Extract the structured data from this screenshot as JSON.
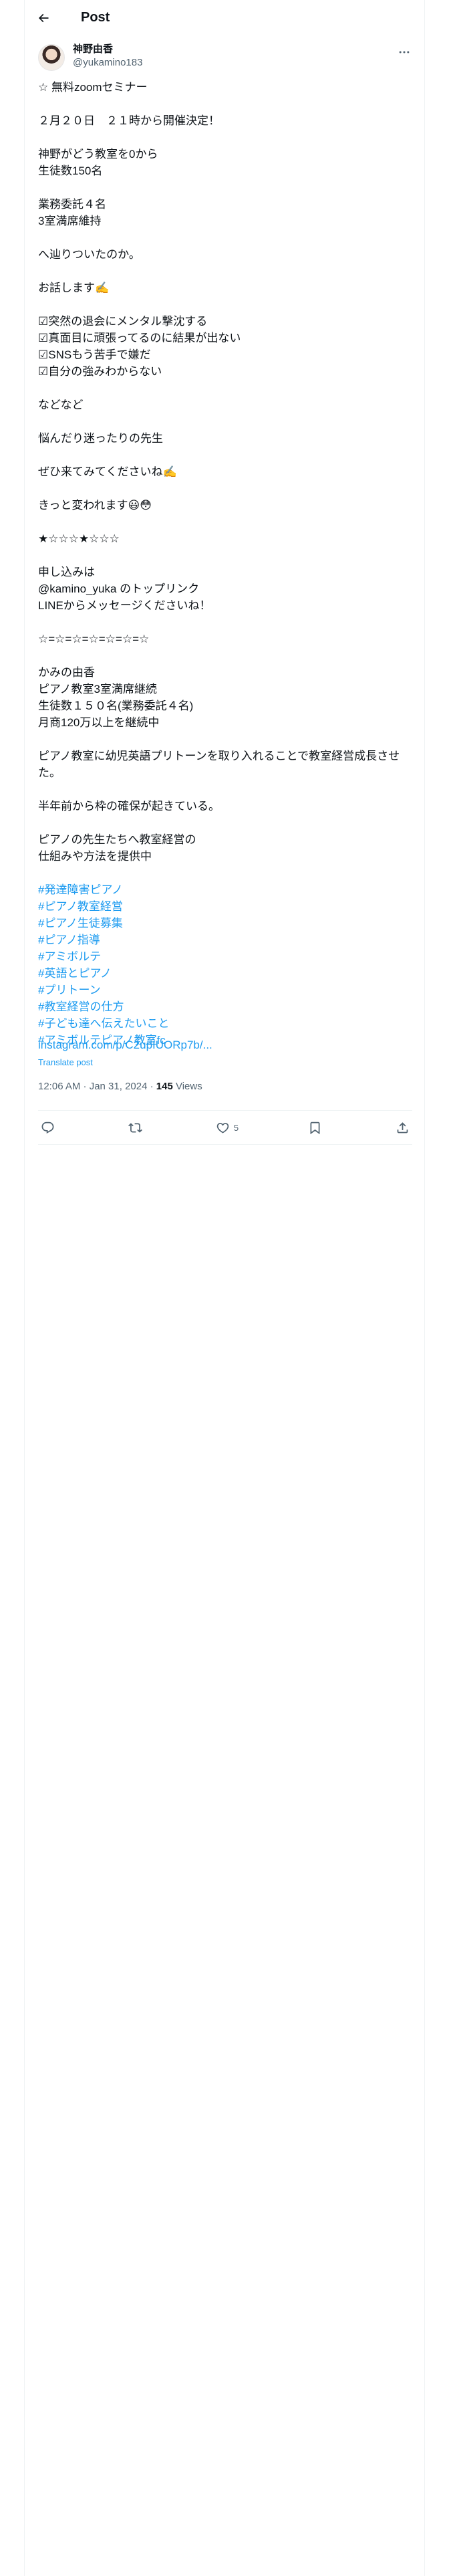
{
  "header": {
    "title": "Post"
  },
  "author": {
    "display_name": "神野由香",
    "handle": "@yukamino183"
  },
  "body_lines": [
    "☆ 無料zoomセミナー",
    "",
    "２月２０日　２１時から開催決定！",
    "",
    "神野がどう教室を0から",
    "生徒数150名",
    "",
    "業務委託４名",
    "3室満席維持",
    "",
    "へ辿りついたのか。",
    "",
    "お話します✍️",
    "",
    "☑︎突然の退会にメンタル撃沈する",
    "☑︎真面目に頑張ってるのに結果が出ない",
    "☑︎SNSもう苦手で嫌だ",
    "☑︎自分の強みわからない",
    "",
    "などなど",
    "",
    "悩んだり迷ったりの先生",
    "",
    "ぜひ来てみてくださいね✍️",
    "",
    "きっと変われます😃😳",
    "",
    "★☆☆☆★☆☆☆",
    "",
    "申し込みは",
    "@kamino_yuka のトップリンク",
    "LINEからメッセージくださいね！",
    "",
    "☆=☆=☆=☆=☆=☆=☆",
    "",
    "かみの由香",
    "ピアノ教室3室満席継続",
    "生徒数１５０名(業務委託４名)",
    "月商120万以上を継続中",
    "",
    "ピアノ教室に幼児英語プリトーンを取り入れることで教室経営成長させた。",
    "",
    "半年前から枠の確保が起きている。",
    "",
    "ピアノの先生たちへ教室経営の",
    "仕組みや方法を提供中",
    ""
  ],
  "hashtags": [
    "#発達障害ピアノ",
    "#ピアノ教室経営",
    "#ピアノ生徒募集",
    "#ピアノ指導",
    "#アミボルテ",
    "#英語とピアノ",
    "#プリトーン",
    "#教室経営の仕方",
    "#子ども達へ伝えたいこと",
    "#アミボルテピアノ教室fc"
  ],
  "link_text": "instagram.com/p/C2upIUORp7b/...",
  "translate_label": "Translate post",
  "meta": {
    "timestamp": "12:06 AM · Jan 31, 2024",
    "separator": " · ",
    "views_count": "145",
    "views_label": " Views"
  },
  "actions": {
    "reply_count": "",
    "repost_count": "",
    "like_count": "5",
    "bookmark_count": ""
  },
  "icons": {
    "back": "back-arrow-icon",
    "more": "more-icon",
    "reply": "reply-icon",
    "repost": "repost-icon",
    "like": "like-icon",
    "bookmark": "bookmark-icon",
    "share": "share-icon"
  },
  "colors": {
    "accent": "#1d9bf0",
    "secondary_text": "#536471",
    "text": "#0f1419",
    "border": "#eff3f4"
  }
}
